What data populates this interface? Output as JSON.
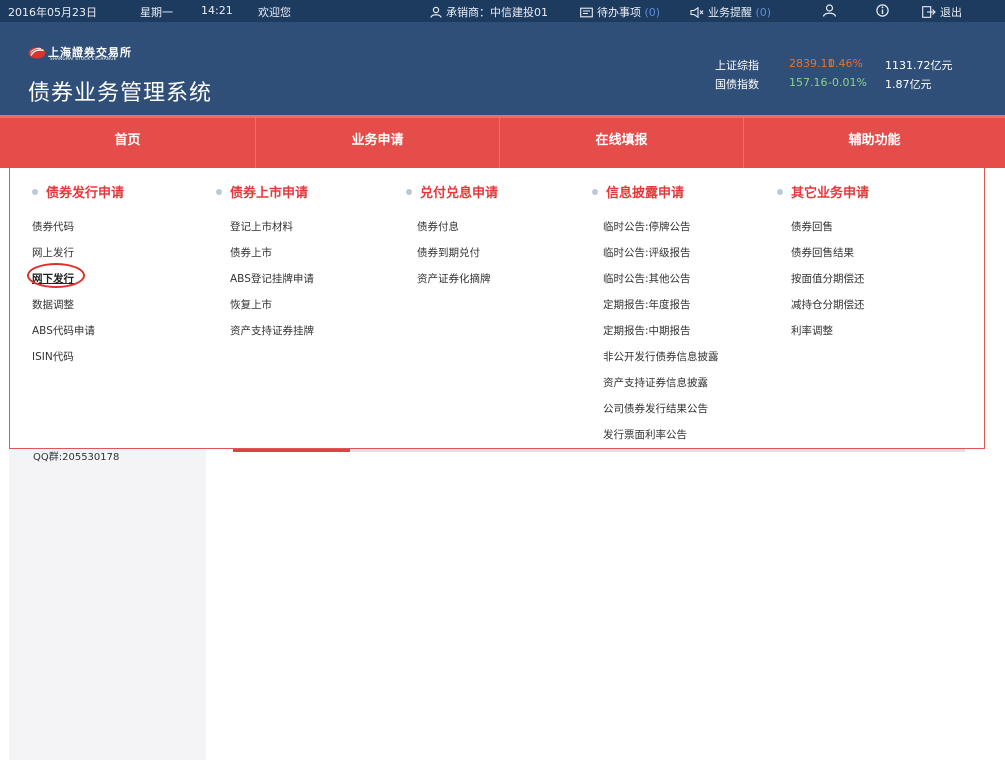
{
  "topbar": {
    "date": "2016年05月23日",
    "weekday": "星期一",
    "time": "14:21",
    "welcome": "欢迎您",
    "underwriter": "承销商：中信建投01",
    "todo_label": "待办事项",
    "todo_count": "(0)",
    "reminder_label": "业务提醒",
    "reminder_count": "(0)",
    "logout": "退出",
    "icons": [
      "user-icon",
      "todo-icon",
      "speaker-icon",
      "people-icon",
      "info-icon",
      "logout-icon"
    ]
  },
  "header": {
    "logo_cn": "上海證券交易所",
    "logo_en": "SHANGHAI STOCK EXCHANGE",
    "system_title": "债券业务管理系统",
    "indices": [
      {
        "label": "上证综指",
        "value": "2839.11",
        "change": "0.46%",
        "turnover": "1131.72亿元",
        "color": "#e2742b"
      },
      {
        "label": "国债指数",
        "value": "157.16",
        "change": "-0.01%",
        "turnover": "1.87亿元",
        "color": "#88d48a"
      }
    ]
  },
  "nav": {
    "tabs": [
      "首页",
      "业务申请",
      "在线填报",
      "辅助功能"
    ]
  },
  "menu": {
    "columns": [
      {
        "title": "债券发行申请",
        "items": [
          "债券代码",
          "网上发行",
          "网下发行",
          "数据调整",
          "ABS代码申请",
          "ISIN代码"
        ]
      },
      {
        "title": "债券上市申请",
        "items": [
          "登记上市材料",
          "债券上市",
          "ABS登记挂牌申请",
          "恢复上市",
          "资产支持证券挂牌"
        ]
      },
      {
        "title": "兑付兑息申请",
        "items": [
          "债券付息",
          "债券到期兑付",
          "资产证券化摘牌"
        ]
      },
      {
        "title": "信息披露申请",
        "items": [
          "临时公告:停牌公告",
          "临时公告:评级报告",
          "临时公告:其他公告",
          "定期报告:年度报告",
          "定期报告:中期报告",
          "非公开发行债券信息披露",
          "资产支持证券信息披露",
          "公司债券发行结果公告",
          "发行票面利率公告"
        ]
      },
      {
        "title": "其它业务申请",
        "items": [
          "债券回售",
          "债券回售结果",
          "按面值分期偿还",
          "减持仓分期偿还",
          "利率调整"
        ]
      }
    ],
    "selected": "网下发行"
  },
  "sidebar": {
    "qq": "QQ群:205530178"
  },
  "colors": {
    "topbar": "#1d3a5f",
    "header": "#2f4f78",
    "nav": "#e54d4b",
    "menu_heading": "#e5383b",
    "highlight_ring": "#e0302e"
  }
}
